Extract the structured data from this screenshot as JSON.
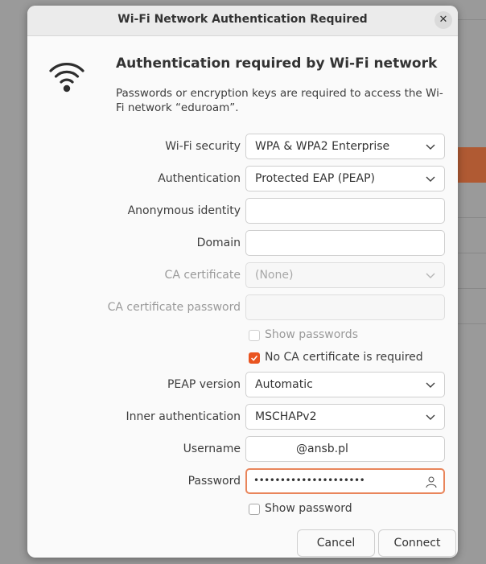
{
  "dialog": {
    "title": "Wi-Fi Network Authentication Required",
    "close_glyph": "✕",
    "heading": "Authentication required by Wi-Fi network",
    "description": "Passwords or encryption keys are required to access the Wi-Fi network “eduroam”."
  },
  "form": {
    "wifi_security": {
      "label": "Wi-Fi security",
      "value": "WPA & WPA2 Enterprise"
    },
    "authentication": {
      "label": "Authentication",
      "value": "Protected EAP (PEAP)"
    },
    "anonymous_identity": {
      "label": "Anonymous identity",
      "value": ""
    },
    "domain": {
      "label": "Domain",
      "value": ""
    },
    "ca_certificate": {
      "label": "CA certificate",
      "value": "(None)"
    },
    "ca_certificate_password": {
      "label": "CA certificate password",
      "value": ""
    },
    "show_passwords": {
      "label": "Show passwords",
      "checked": false
    },
    "no_ca_required": {
      "label": "No CA certificate is required",
      "checked": true
    },
    "peap_version": {
      "label": "PEAP version",
      "value": "Automatic"
    },
    "inner_authentication": {
      "label": "Inner authentication",
      "value": "MSCHAPv2"
    },
    "username": {
      "label": "Username",
      "value": "@ansb.pl"
    },
    "password": {
      "label": "Password",
      "value": "•••••••••••••••••••••"
    },
    "show_password": {
      "label": "Show password",
      "checked": false
    }
  },
  "buttons": {
    "cancel": "Cancel",
    "connect": "Connect"
  },
  "colors": {
    "accent": "#e95420",
    "focus_border": "#e9855b"
  },
  "icons": {
    "network": "wifi-icon",
    "dropdown": "chevron-down-icon",
    "user": "user-icon",
    "close": "close-icon"
  }
}
